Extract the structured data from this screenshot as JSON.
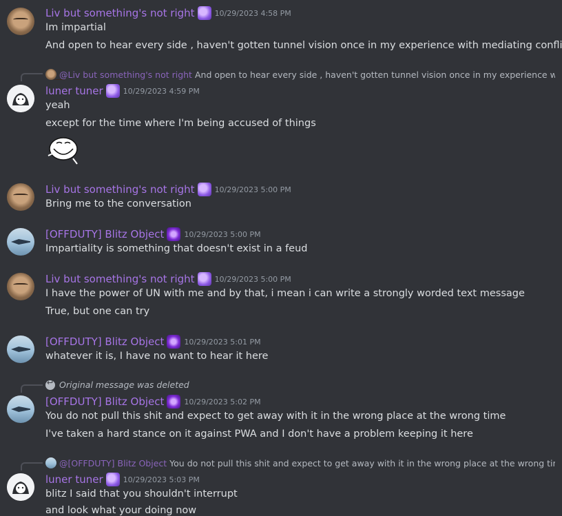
{
  "messages": [
    {
      "author": "Liv but something's not right",
      "timestamp": "10/29/2023 4:58 PM",
      "lines": [
        "Im impartial",
        "And open to hear every side , haven't gotten tunnel vision once in my experience with mediating conflicts"
      ]
    },
    {
      "reply": {
        "author": "@Liv but something's not right",
        "text": "And open to hear every side , haven't gotten tunnel vision once in my experience with mediating conflicts"
      },
      "author": "luner tuner",
      "timestamp": "10/29/2023 4:59 PM",
      "lines": [
        "yeah",
        "except for the time where I'm being accused of things"
      ],
      "sticker": "trollface-sticker"
    },
    {
      "author": "Liv but something's not right",
      "timestamp": "10/29/2023 5:00 PM",
      "lines": [
        "Bring me to the conversation"
      ]
    },
    {
      "author": "[OFFDUTY] Blitz Object",
      "timestamp": "10/29/2023 5:00 PM",
      "lines": [
        "Impartiality is something that doesn't exist in a feud"
      ]
    },
    {
      "author": "Liv but something's not right",
      "timestamp": "10/29/2023 5:00 PM",
      "lines": [
        "I have the power of UN with me and by that, i mean i can write a strongly worded text message",
        "True, but one can try"
      ]
    },
    {
      "author": "[OFFDUTY] Blitz Object",
      "timestamp": "10/29/2023 5:01 PM",
      "lines": [
        "whatever it is, I have no want to hear it here"
      ]
    },
    {
      "reply": {
        "deleted_text": "Original message was deleted"
      },
      "author": "[OFFDUTY] Blitz Object",
      "timestamp": "10/29/2023 5:02 PM",
      "lines": [
        "You do not pull this shit and expect to get away with it in the wrong place at the wrong time",
        "I've taken a hard stance on it against PWA and I don't have a problem keeping it here"
      ]
    },
    {
      "reply": {
        "author": "@[OFFDUTY] Blitz Object",
        "text": "You do not pull this shit and expect to get away with it in the wrong place at the wrong time"
      },
      "author": "luner tuner",
      "timestamp": "10/29/2023 5:03 PM",
      "lines": [
        "blitz I said that you shouldn't interrupt",
        "and look what your doing now"
      ]
    }
  ]
}
